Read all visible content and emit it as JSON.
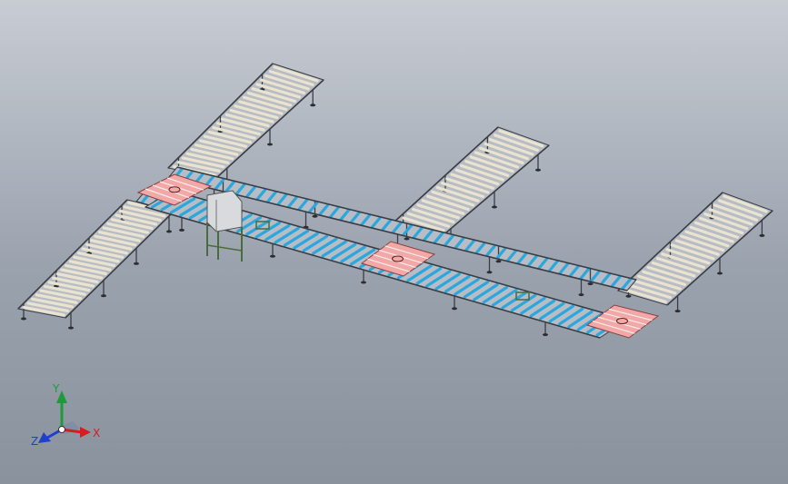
{
  "viewport": {
    "background_top": "#c8ccd3",
    "background_bottom": "#8a929d"
  },
  "model": {
    "roller_color_light": "#e9e3cf",
    "roller_color_blue": "#2aa7dd",
    "transfer_pad_color": "#f2a8a6",
    "frame_color": "#3a3d44",
    "control_cabinet_color": "#d9dadd",
    "support_color": "#4a6b3a"
  },
  "triad": {
    "x_label": "X",
    "y_label": "Y",
    "z_label": "Z",
    "x_color": "#d11f1f",
    "y_color": "#1f9a3a",
    "z_color": "#1f3fd1"
  }
}
